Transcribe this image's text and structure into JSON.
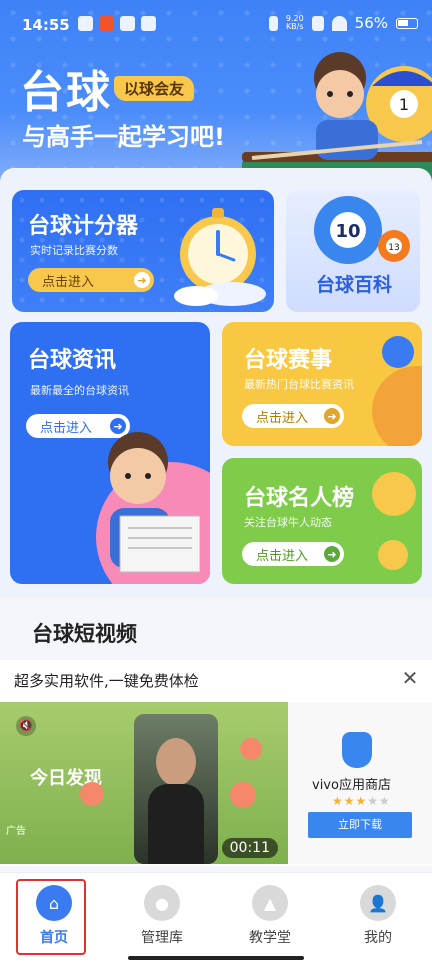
{
  "status": {
    "time": "14:55",
    "net_speed_value": "9.20",
    "net_speed_unit": "KB/s",
    "battery": "56%"
  },
  "hero": {
    "title": "台球",
    "badge": "以球会友",
    "subtitle": "与高手一起学习吧!"
  },
  "cards": {
    "scorer": {
      "title": "台球计分器",
      "desc": "实时记录比赛分数",
      "button": "点击进入"
    },
    "wiki": {
      "title": "台球百科",
      "ball_number": "10",
      "ball_small": "13"
    },
    "news": {
      "title": "台球资讯",
      "desc": "最新最全的台球资讯",
      "button": "点击进入"
    },
    "events": {
      "title": "台球赛事",
      "desc": "最新热门台球比赛资讯",
      "button": "点击进入"
    },
    "fame": {
      "title": "台球名人榜",
      "desc": "关注台球牛人动态",
      "button": "点击进入"
    }
  },
  "videos": {
    "title": "台球短视频"
  },
  "ad": {
    "title": "超多实用软件,一键免费体检",
    "media_caption": "今日发现",
    "ad_label": "广告",
    "duration": "00:11",
    "store_name": "vivo应用商店",
    "rating_stars": 3,
    "rating_max": 5,
    "download_button": "立即下载"
  },
  "tabs": [
    {
      "label": "首页",
      "icon": "home-icon",
      "active": true
    },
    {
      "label": "管理库",
      "icon": "billiard-ball-icon",
      "active": false
    },
    {
      "label": "教学堂",
      "icon": "triangle-rack-icon",
      "active": false
    },
    {
      "label": "我的",
      "icon": "user-icon",
      "active": false
    }
  ],
  "colors": {
    "primary": "#3a7bf2",
    "accent_yellow": "#f9c842",
    "accent_green": "#7fcc4a",
    "badge": "#f7c84b"
  }
}
